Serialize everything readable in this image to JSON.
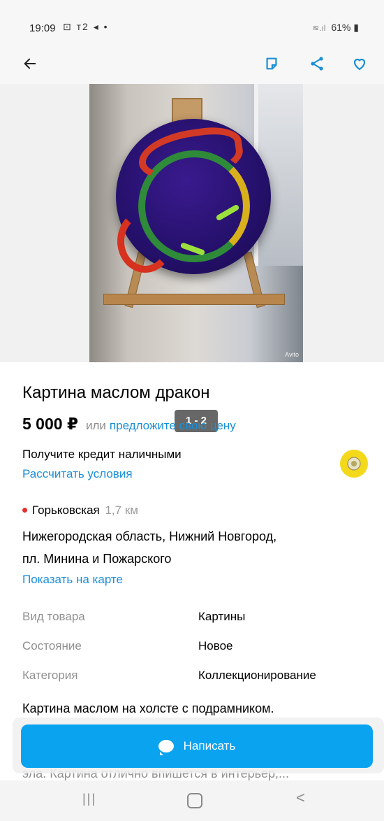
{
  "status_bar": {
    "time": "19:09",
    "left_icons": "⊡ т2 ◂ •",
    "battery": "61%",
    "signal_text": "≋.ıl"
  },
  "app_bar": {
    "back_icon": "arrow-left-icon",
    "note_icon": "note-icon",
    "share_icon": "share-icon",
    "favorite_icon": "heart-icon",
    "accent_color": "#1a8fd6"
  },
  "gallery": {
    "counter": "1 - 2",
    "watermark": "Avito"
  },
  "listing": {
    "title": "Картина маслом дракон",
    "price": "5 000 ₽",
    "or_text": "или",
    "offer_link": "предложите свою цену",
    "credit_text": "Получите кредит наличными",
    "credit_link": "Рассчитать условия",
    "metro_station": "Горьковская",
    "metro_distance": "1,7 км",
    "metro_color": "#e52f2f",
    "address_line1": "Нижегородская область, Нижний Новгород,",
    "address_line2": "пл. Минина и Пожарского",
    "map_link": "Показать на карте",
    "params": [
      {
        "label": "Вид товара",
        "value": "Картины"
      },
      {
        "label": "Состояние",
        "value": "Новое"
      },
      {
        "label": "Категория",
        "value": "Коллекционирование"
      }
    ],
    "description": "Картина маслом на холсте с подрамником.",
    "description_cut": "эла. Картина отлично впишется в интерьер,..."
  },
  "actions": {
    "write_button": "Написать",
    "button_color": "#0aa3f0"
  },
  "nav_bar": {
    "recent": "|||",
    "back": "<"
  }
}
